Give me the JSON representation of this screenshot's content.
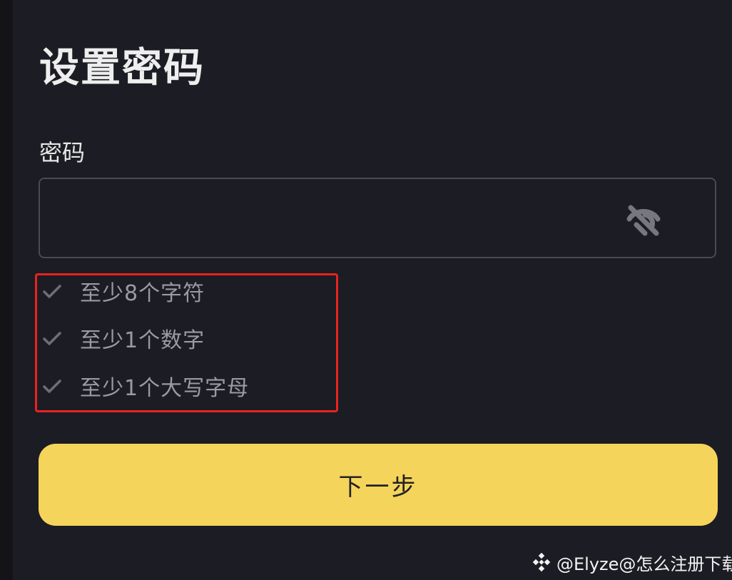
{
  "page": {
    "title": "设置密码"
  },
  "password_field": {
    "label": "密码",
    "value": "",
    "placeholder": "",
    "visibility_icon": "eye-off-icon"
  },
  "rules": [
    {
      "icon": "check-icon",
      "text": "至少8个字符"
    },
    {
      "icon": "check-icon",
      "text": "至少1个数字"
    },
    {
      "icon": "check-icon",
      "text": "至少1个大写字母"
    }
  ],
  "actions": {
    "next_label": "下一步"
  },
  "watermark": {
    "text": "@Elyze@怎么注册下载",
    "logo_icon": "binance-logo-icon"
  },
  "colors": {
    "background": "#1c1c24",
    "primary_button": "#f5d45b",
    "highlight_border": "#e8231f",
    "rule_text": "#9a9aa2",
    "input_border": "#4a4a52"
  }
}
